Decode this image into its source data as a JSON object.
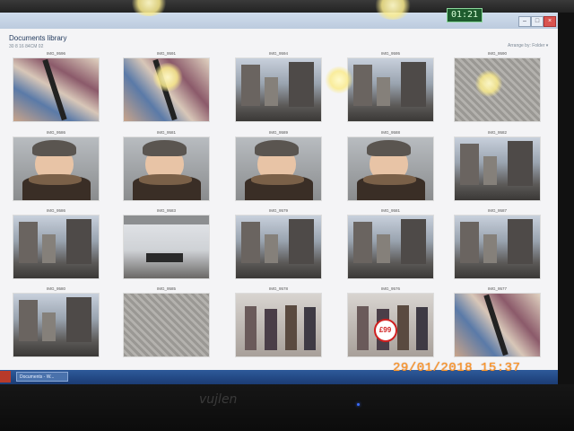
{
  "window": {
    "title": "Documents library",
    "subtitle": "30 8 16 84CM 02",
    "arrange": "Arrange by: Folder ▾"
  },
  "overlay": {
    "timer": "01:21",
    "timestamp": "29/01/2018  15:37",
    "brand": "vujlen"
  },
  "taskbar": {
    "item": "Documents - W..."
  },
  "photos": [
    {
      "caption": "IMG_9596",
      "scene": "fabric"
    },
    {
      "caption": "IMG_9591",
      "scene": "fabric"
    },
    {
      "caption": "IMG_9594",
      "scene": "street"
    },
    {
      "caption": "IMG_9595",
      "scene": "street"
    },
    {
      "caption": "IMG_9590",
      "scene": "pavement"
    },
    {
      "caption": "IMG_9586",
      "scene": "portrait"
    },
    {
      "caption": "IMG_9581",
      "scene": "portrait"
    },
    {
      "caption": "IMG_9589",
      "scene": "portrait"
    },
    {
      "caption": "IMG_9588",
      "scene": "portrait"
    },
    {
      "caption": "IMG_9582",
      "scene": "street"
    },
    {
      "caption": "IMG_9586",
      "scene": "street"
    },
    {
      "caption": "IMG_9583",
      "scene": "shelter"
    },
    {
      "caption": "IMG_9579",
      "scene": "street"
    },
    {
      "caption": "IMG_9581",
      "scene": "street"
    },
    {
      "caption": "IMG_9587",
      "scene": "street"
    },
    {
      "caption": "IMG_9580",
      "scene": "street"
    },
    {
      "caption": "IMG_9585",
      "scene": "pavement"
    },
    {
      "caption": "IMG_9578",
      "scene": "shop"
    },
    {
      "caption": "IMG_9576",
      "scene": "shop",
      "sign": "£99"
    },
    {
      "caption": "IMG_9577",
      "scene": "fabric"
    }
  ]
}
